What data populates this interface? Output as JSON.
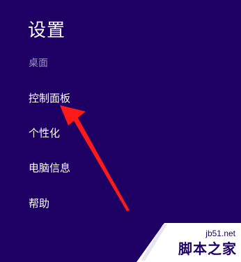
{
  "settings": {
    "title": "设置",
    "subtitle": "桌面",
    "items": [
      {
        "label": "控制面板"
      },
      {
        "label": "个性化"
      },
      {
        "label": "电脑信息"
      },
      {
        "label": "帮助"
      }
    ]
  },
  "watermark": {
    "url": "jb51.net",
    "name": "脚本之家"
  },
  "colors": {
    "background": "#1e0064",
    "text": "#ffffff",
    "subtitle": "#9b8fc2",
    "arrow": "#ff1a1a"
  }
}
